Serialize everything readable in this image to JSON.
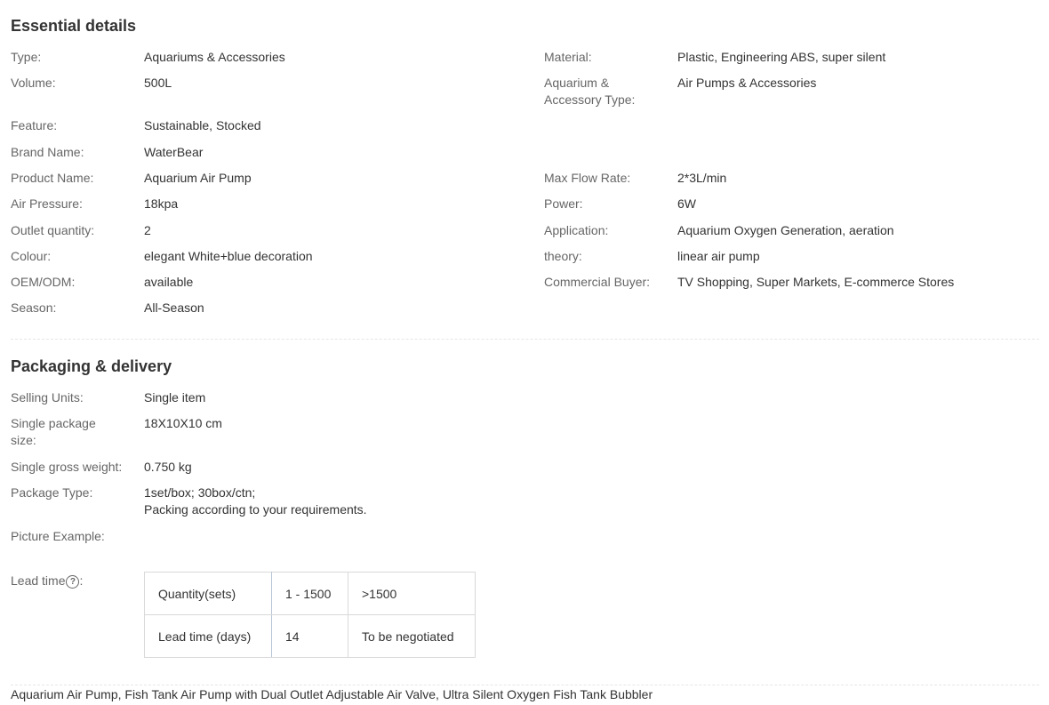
{
  "essential": {
    "title": "Essential details",
    "left": [
      {
        "label": "Type:",
        "value": "Aquariums & Accessories"
      },
      {
        "label": "Volume:",
        "value": "500L"
      },
      {
        "label": "Feature:",
        "value": "Sustainable, Stocked"
      },
      {
        "label": "Brand Name:",
        "value": "WaterBear"
      },
      {
        "label": "Product Name:",
        "value": "Aquarium Air Pump"
      },
      {
        "label": "Air Pressure:",
        "value": "18kpa"
      },
      {
        "label": "Outlet quantity:",
        "value": "2"
      },
      {
        "label": "Colour:",
        "value": "elegant White+blue decoration"
      },
      {
        "label": "OEM/ODM:",
        "value": "available"
      },
      {
        "label": "Season:",
        "value": "All-Season"
      }
    ],
    "right": [
      {
        "label": "Material:",
        "value": "Plastic, Engineering ABS, super silent"
      },
      {
        "label_line1": "Aquarium &",
        "label_line2": "Accessory Type:",
        "value": "Air Pumps & Accessories"
      },
      {
        "label": "Max Flow Rate:",
        "value": "2*3L/min"
      },
      {
        "label": "Power:",
        "value": "6W"
      },
      {
        "label": "Application:",
        "value": "Aquarium Oxygen Generation, aeration"
      },
      {
        "label": "theory:",
        "value": "linear air pump"
      },
      {
        "label": "Commercial Buyer:",
        "value": "TV Shopping, Super Markets, E-commerce Stores"
      }
    ]
  },
  "packaging": {
    "title": "Packaging & delivery",
    "selling_units": {
      "label": "Selling Units:",
      "value": "Single item"
    },
    "package_size": {
      "label_line1": "Single package",
      "label_line2": "size:",
      "value": "18X10X10 cm"
    },
    "gross_weight": {
      "label": "Single gross weight:",
      "value": "0.750 kg"
    },
    "package_type": {
      "label": "Package Type:",
      "value_line1": "1set/box; 30box/ctn;",
      "value_line2": "Packing according to your requirements."
    },
    "picture_example": {
      "label": "Picture Example:"
    },
    "lead_time": {
      "label": "Lead time",
      "help_icon": "question-circle-icon",
      "rows": [
        [
          "Quantity(sets)",
          "1 - 1500",
          ">1500"
        ],
        [
          "Lead time (days)",
          "14",
          "To be negotiated"
        ]
      ]
    }
  },
  "footer_text": "Aquarium Air Pump, Fish Tank Air Pump with Dual Outlet Adjustable Air Valve, Ultra Silent Oxygen Fish Tank Bubbler"
}
